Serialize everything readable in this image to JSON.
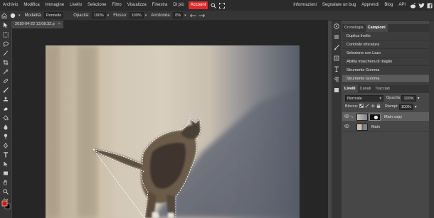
{
  "menubar": {
    "items": [
      "Archivio",
      "Modifica",
      "Immagine",
      "Livello",
      "Selezione",
      "Filtro",
      "Visualizza",
      "Finestra",
      "Di più"
    ],
    "account_label": "Account",
    "right_items": [
      "Informazioni",
      "Segnalare un bug",
      "Apprendi",
      "Blog",
      "API"
    ],
    "accent_color": "#e02a2a"
  },
  "options": {
    "mode_label": "Modalità:",
    "mode_value": "Pennello",
    "opacity_label": "Opacità:",
    "opacity_value": "100%",
    "flow_label": "Flusso:",
    "flow_value": "100%",
    "round_label": "Arrotonda:",
    "round_value": "0%"
  },
  "document": {
    "tab_title": "2018-04-22 13.08.32.p",
    "close_glyph": "×"
  },
  "history_panel": {
    "tabs": [
      "Cronologia",
      "Campioni"
    ],
    "active_tab": "Campioni",
    "items": [
      "Duplica livello",
      "Controllo sfocatura",
      "Selezione con Lazo",
      "Abilita maschera di ritaglio",
      "Strumento Gomma",
      "Strumento Gomma"
    ]
  },
  "layers_panel": {
    "tabs": [
      "Livelli",
      "Canali",
      "Tracciati"
    ],
    "active_tab": "Livelli",
    "blend_mode": "Normale",
    "opacity_label": "Opacità:",
    "opacity_value": "100%",
    "lock_label": "Blocca:",
    "fill_label": "Riempi:",
    "fill_value": "100%",
    "layers": [
      {
        "name": "Main copy",
        "selected": true
      },
      {
        "name": "Main",
        "selected": false
      }
    ]
  },
  "icons": {
    "search": "search-icon",
    "fullscreen": "fullscreen-icon",
    "reddit": "reddit-icon",
    "twitter": "twitter-icon",
    "facebook": "facebook-icon"
  },
  "colors": {
    "foreground": "#e01010",
    "background": "#000000"
  }
}
